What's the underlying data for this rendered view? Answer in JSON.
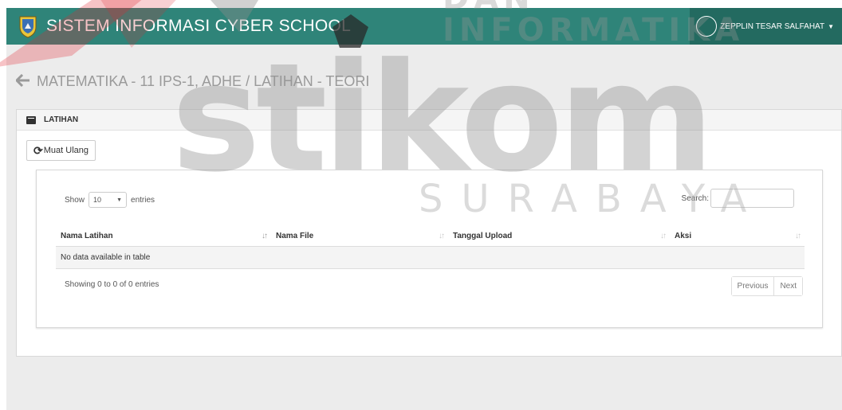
{
  "navbar": {
    "title": "SISTEM INFORMASI CYBER SCHOOL",
    "user_name": "ZEPPLIN TESAR SALFAHAT",
    "accent": "#2f8479"
  },
  "page": {
    "title": "MATEMATIKA - 11 IPS-1, ADHE / LATIHAN - TEORI"
  },
  "panel": {
    "title": "LATIHAN",
    "reload_label": "Muat Ulang"
  },
  "table_controls": {
    "show_label": "Show",
    "page_length": "10",
    "entries_label": "entries",
    "search_label": "Search:"
  },
  "table": {
    "columns": [
      "Nama Latihan",
      "Nama File",
      "Tanggal Upload",
      "Aksi"
    ],
    "empty_message": "No data available in table",
    "info": "Showing 0 to 0 of 0 entries"
  },
  "pagination": {
    "previous": "Previous",
    "next": "Next"
  },
  "watermark": {
    "main": "stikom",
    "sub": "SURABAYA",
    "top": "DAN INFORMATIKA"
  },
  "icons": {
    "logo": "school-crest-icon",
    "back": "arrow-left-icon",
    "panel": "book-icon",
    "reload": "refresh-icon",
    "sort": "sort-icon"
  }
}
